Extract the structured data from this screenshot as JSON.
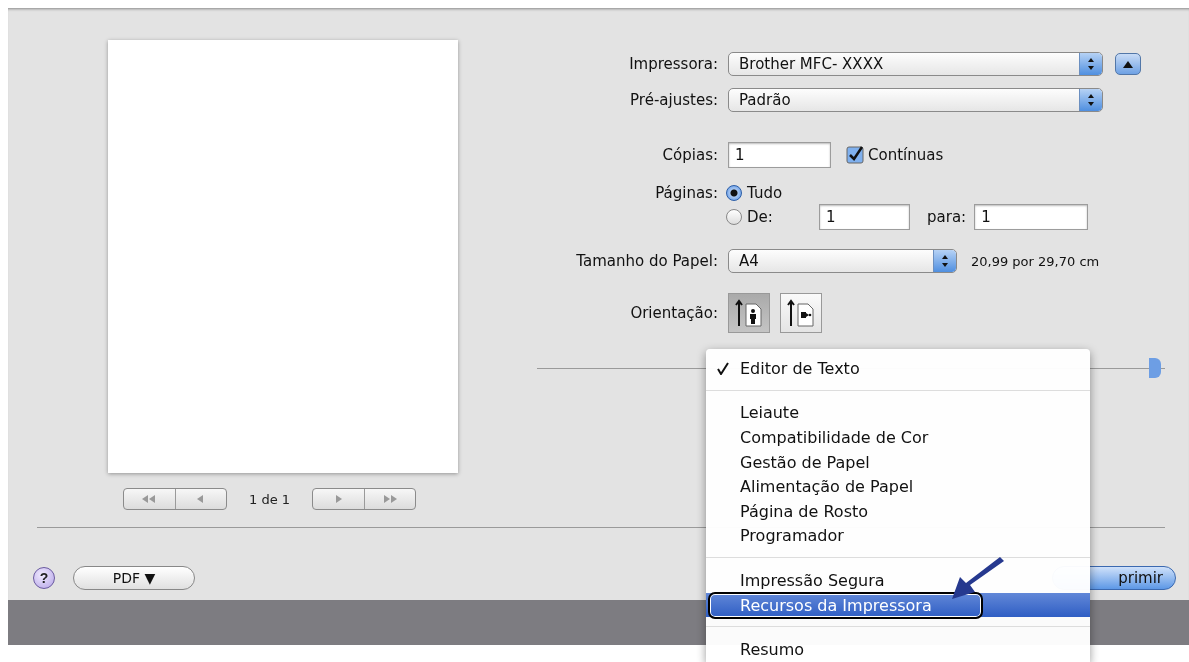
{
  "printer": {
    "label": "Impressora:",
    "value": "Brother MFC- XXXX"
  },
  "presets": {
    "label": "Pré-ajustes:",
    "value": "Padrão"
  },
  "copies": {
    "label": "Cópias:",
    "value": "1",
    "collated": {
      "label": "Contínuas",
      "checked": true
    }
  },
  "pages": {
    "label": "Páginas:",
    "options": [
      {
        "label": "Tudo",
        "selected": true
      },
      {
        "label": "De:",
        "selected": false
      }
    ],
    "from": "1",
    "to_label": "para:",
    "to": "1"
  },
  "paper_size": {
    "label": "Tamanho do Papel:",
    "value": "A4",
    "dimensions": "20,99 por 29,70 cm"
  },
  "orientation": {
    "label": "Orientação:",
    "options": [
      {
        "kind": "portrait",
        "selected": true
      },
      {
        "kind": "landscape",
        "selected": false
      }
    ]
  },
  "preview": {
    "page_counter": "1 de 1"
  },
  "help_button": "?",
  "pdf_button": "PDF ▼",
  "print_button": "primir",
  "menu": {
    "groups": [
      [
        {
          "label": "Editor de Texto",
          "checked": true,
          "selected": false
        }
      ],
      [
        {
          "label": "Leiaute",
          "checked": false,
          "selected": false
        },
        {
          "label": "Compatibilidade de Cor",
          "checked": false,
          "selected": false
        },
        {
          "label": "Gestão de Papel",
          "checked": false,
          "selected": false
        },
        {
          "label": "Alimentação de Papel",
          "checked": false,
          "selected": false
        },
        {
          "label": "Página de Rosto",
          "checked": false,
          "selected": false
        },
        {
          "label": "Programador",
          "checked": false,
          "selected": false
        }
      ],
      [
        {
          "label": "Impressão Segura",
          "checked": false,
          "selected": false
        },
        {
          "label": "Recursos da Impressora",
          "checked": false,
          "selected": true
        }
      ],
      [
        {
          "label": "Resumo",
          "checked": false,
          "selected": false
        }
      ]
    ]
  }
}
